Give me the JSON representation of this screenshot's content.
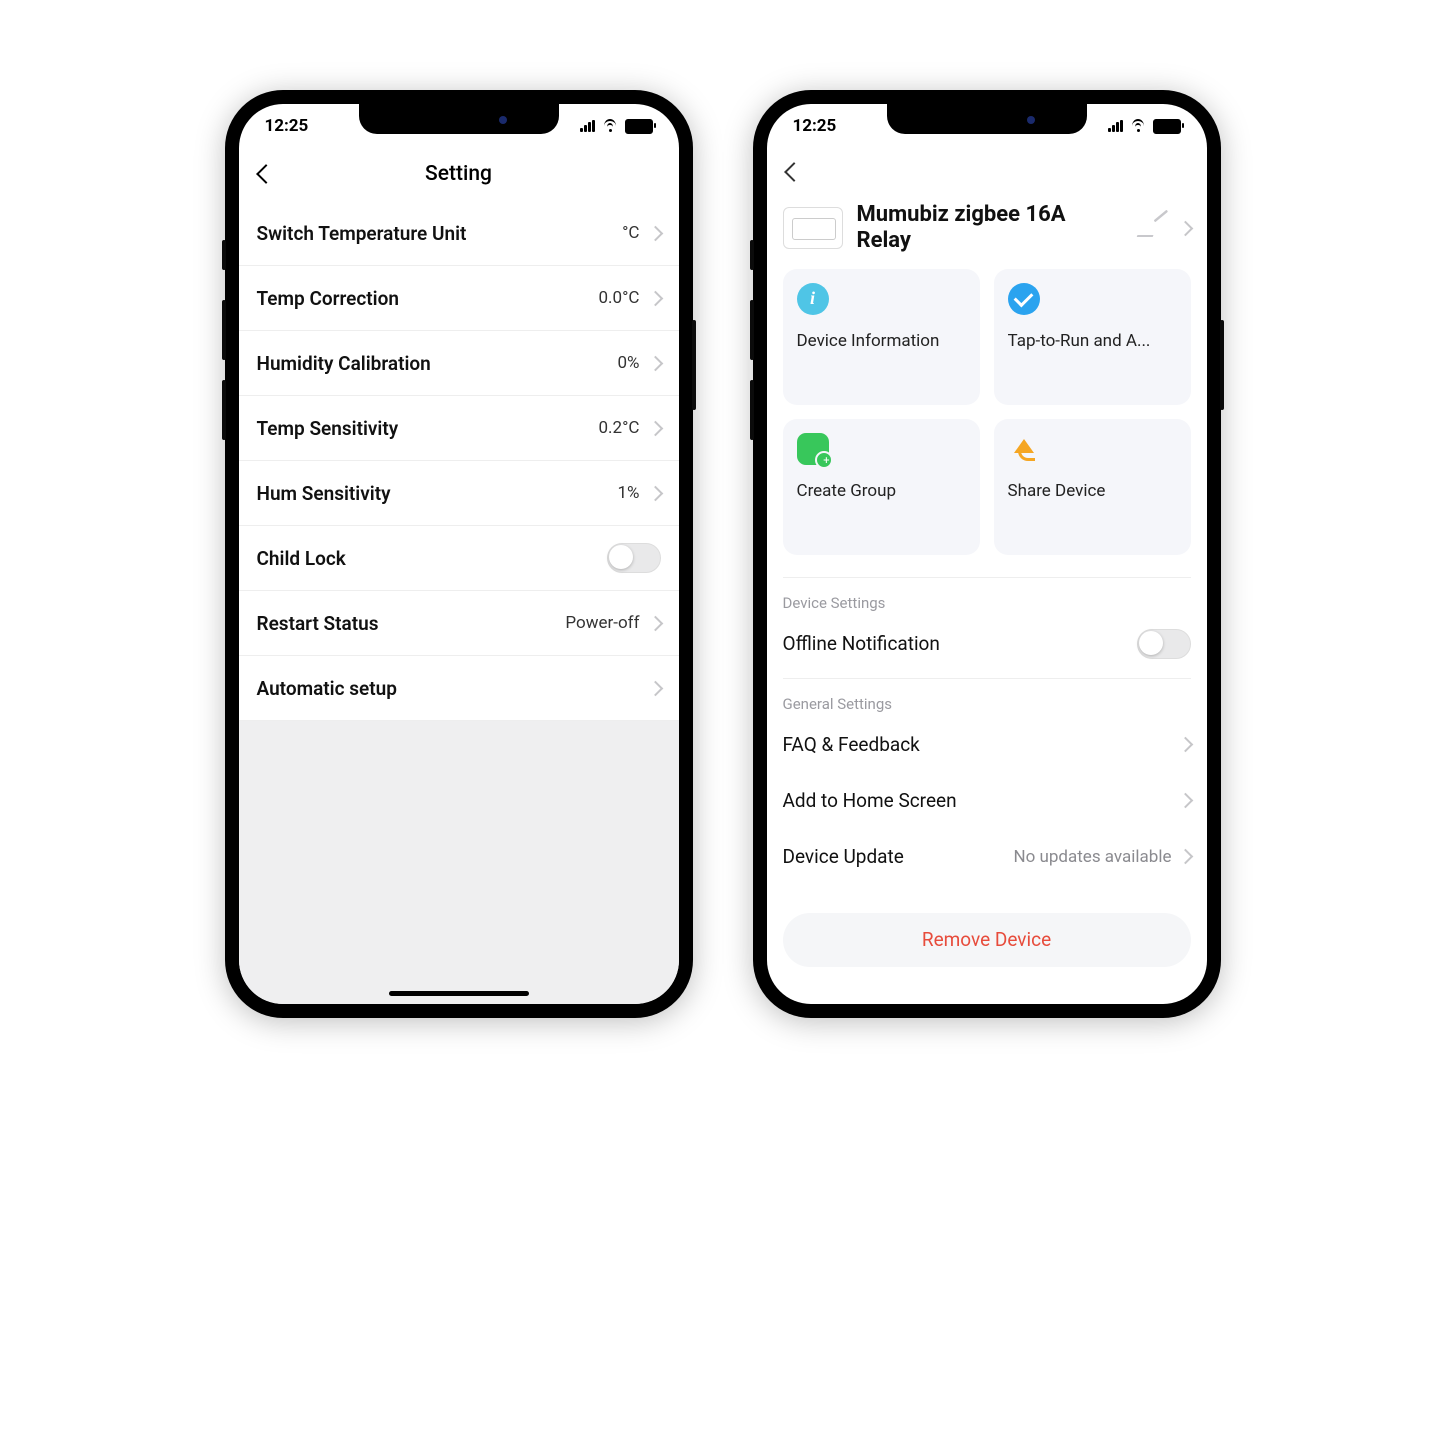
{
  "status_time": "12:25",
  "left": {
    "title": "Setting",
    "rows": [
      {
        "label": "Switch Temperature Unit",
        "value": "°C",
        "kind": "nav"
      },
      {
        "label": "Temp Correction",
        "value": "0.0°C",
        "kind": "nav"
      },
      {
        "label": "Humidity Calibration",
        "value": "0%",
        "kind": "nav"
      },
      {
        "label": "Temp Sensitivity",
        "value": "0.2°C",
        "kind": "nav"
      },
      {
        "label": "Hum Sensitivity",
        "value": "1%",
        "kind": "nav"
      },
      {
        "label": "Child Lock",
        "value": "",
        "kind": "toggle",
        "on": false
      },
      {
        "label": "Restart Status",
        "value": "Power-off",
        "kind": "nav"
      },
      {
        "label": "Automatic setup",
        "value": "",
        "kind": "nav"
      }
    ]
  },
  "right": {
    "device_name": "Mumubiz zigbee 16A Relay",
    "tiles": [
      {
        "id": "device-information",
        "label": "Device Information",
        "icon": "info"
      },
      {
        "id": "tap-to-run",
        "label": "Tap-to-Run and A...",
        "icon": "check"
      },
      {
        "id": "create-group",
        "label": "Create Group",
        "icon": "group"
      },
      {
        "id": "share-device",
        "label": "Share Device",
        "icon": "share"
      }
    ],
    "device_settings_title": "Device Settings",
    "offline_notification_label": "Offline Notification",
    "offline_notification_on": false,
    "general_settings_title": "General Settings",
    "general_rows": [
      {
        "label": "FAQ & Feedback",
        "value": ""
      },
      {
        "label": "Add to Home Screen",
        "value": ""
      },
      {
        "label": "Device Update",
        "value": "No updates available"
      }
    ],
    "remove_label": "Remove Device"
  }
}
